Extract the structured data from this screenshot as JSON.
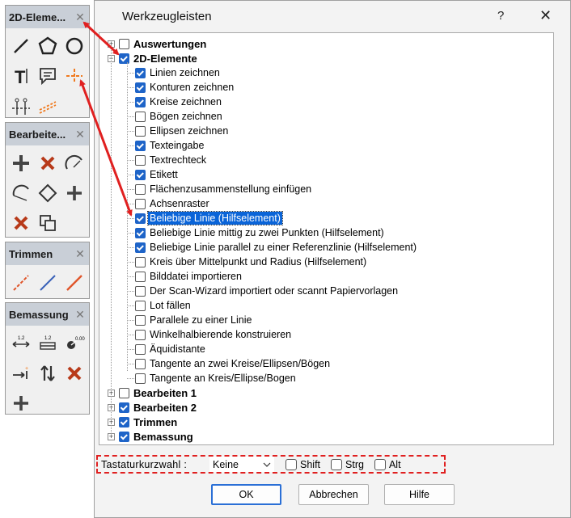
{
  "toolbars": [
    {
      "title": "2D-Eleme...",
      "icons": [
        "line-tool-icon",
        "polygon-tool-icon",
        "circle-tool-icon",
        "text-tool-icon",
        "label-tool-icon",
        "helper-line-tool-icon",
        "axis-grid-tool-icon",
        "parallel-helper-line-icon"
      ]
    },
    {
      "title": "Bearbeite...",
      "icons": [
        "move-tool-icon",
        "delete-tool-icon",
        "arc-edit-icon",
        "arc-edit-2-icon",
        "rhombus-edit-icon",
        "cross-tool-icon",
        "delete-tool-2-icon",
        "copy-tool-icon"
      ]
    },
    {
      "title": "Trimmen",
      "icons": [
        "trim-line-icon",
        "trim-line-2-icon",
        "trim-line-3-icon"
      ]
    },
    {
      "title": "Bemassung",
      "icons": [
        "dimension-horizontal-icon",
        "dimension-vertical-icon",
        "dimension-angle-icon",
        "dimension-point-icon",
        "swap-arrows-icon",
        "delete-dimension-icon",
        "move-dimension-icon"
      ]
    }
  ],
  "dialog": {
    "title": "Werkzeugleisten",
    "help": "?",
    "close": "✕",
    "tree": [
      {
        "label": "Auswertungen",
        "checked": false,
        "level": 0,
        "expander": "+",
        "bold": true
      },
      {
        "label": "2D-Elemente",
        "checked": true,
        "level": 0,
        "expander": "−",
        "bold": true
      },
      {
        "label": "Linien zeichnen",
        "checked": true,
        "level": 1
      },
      {
        "label": "Konturen zeichnen",
        "checked": true,
        "level": 1
      },
      {
        "label": "Kreise zeichnen",
        "checked": true,
        "level": 1
      },
      {
        "label": "Bögen zeichnen",
        "checked": false,
        "level": 1
      },
      {
        "label": "Ellipsen zeichnen",
        "checked": false,
        "level": 1
      },
      {
        "label": "Texteingabe",
        "checked": true,
        "level": 1
      },
      {
        "label": "Textrechteck",
        "checked": false,
        "level": 1
      },
      {
        "label": "Etikett",
        "checked": true,
        "level": 1
      },
      {
        "label": "Flächenzusammenstellung einfügen",
        "checked": false,
        "level": 1
      },
      {
        "label": "Achsenraster",
        "checked": false,
        "level": 1
      },
      {
        "label": "Beliebige Linie (Hilfselement)",
        "checked": true,
        "level": 1,
        "selected": true
      },
      {
        "label": "Beliebige Linie mittig zu zwei Punkten (Hilfselement)",
        "checked": true,
        "level": 1
      },
      {
        "label": "Beliebige Linie parallel zu einer Referenzlinie (Hilfselement)",
        "checked": true,
        "level": 1
      },
      {
        "label": "Kreis über Mittelpunkt und Radius (Hilfselement)",
        "checked": false,
        "level": 1
      },
      {
        "label": "Bilddatei importieren",
        "checked": false,
        "level": 1
      },
      {
        "label": "Der Scan-Wizard importiert oder scannt Papiervorlagen",
        "checked": false,
        "level": 1
      },
      {
        "label": "Lot fällen",
        "checked": false,
        "level": 1
      },
      {
        "label": "Parallele zu einer Linie",
        "checked": false,
        "level": 1
      },
      {
        "label": "Winkelhalbierende konstruieren",
        "checked": false,
        "level": 1
      },
      {
        "label": "Äquidistante",
        "checked": false,
        "level": 1
      },
      {
        "label": "Tangente an zwei Kreise/Ellipsen/Bögen",
        "checked": false,
        "level": 1
      },
      {
        "label": "Tangente an Kreis/Ellipse/Bogen",
        "checked": false,
        "level": 1
      },
      {
        "label": "Bearbeiten 1",
        "checked": false,
        "level": 0,
        "expander": "+",
        "bold": true
      },
      {
        "label": "Bearbeiten 2",
        "checked": true,
        "level": 0,
        "expander": "+",
        "bold": true
      },
      {
        "label": "Trimmen",
        "checked": true,
        "level": 0,
        "expander": "+",
        "bold": true
      },
      {
        "label": "Bemassung",
        "checked": true,
        "level": 0,
        "expander": "+",
        "bold": true
      }
    ],
    "shortcut": {
      "label": "Tastaturkurzwahl :",
      "value": "Keine",
      "modifiers": [
        {
          "label": "Shift",
          "checked": false
        },
        {
          "label": "Strg",
          "checked": false
        },
        {
          "label": "Alt",
          "checked": false
        }
      ]
    },
    "buttons": {
      "ok": "OK",
      "cancel": "Abbrechen",
      "help": "Hilfe"
    }
  },
  "colors": {
    "accent": "#1e64c8",
    "selection": "#0a64d8",
    "annotation": "#e02020",
    "tool_orange": "#f07a1e"
  }
}
